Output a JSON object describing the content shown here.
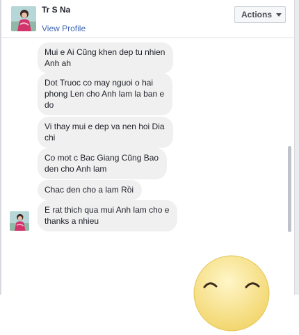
{
  "header": {
    "contact_name": "Tr S Na",
    "view_profile_label": "View Profile",
    "actions_label": "Actions"
  },
  "messages": [
    {
      "text": "Mui e Ai Cũng khen dep tu nhien\nAnh ah"
    },
    {
      "text": "Dot Truoc co may nguoi o hai\nphong Len cho Anh lam la ban e\ndo"
    },
    {
      "text": "Vi thay mui e dep va nen hoi Dia\nchi"
    },
    {
      "text": "Co mot c Bac Giang Cũng Bao\nden cho Anh lam"
    },
    {
      "text": "Chac den cho a lam Rồi"
    },
    {
      "text": "E rat thich qua mui Anh lam cho e\nthanks a nhieu"
    }
  ],
  "sticker": {
    "icon": "smiley-sticker-icon"
  },
  "colors": {
    "link": "#4267b2",
    "bubble": "#f1f0f0",
    "text": "#1d2129",
    "sticker_yellow": "#f7e08a"
  }
}
